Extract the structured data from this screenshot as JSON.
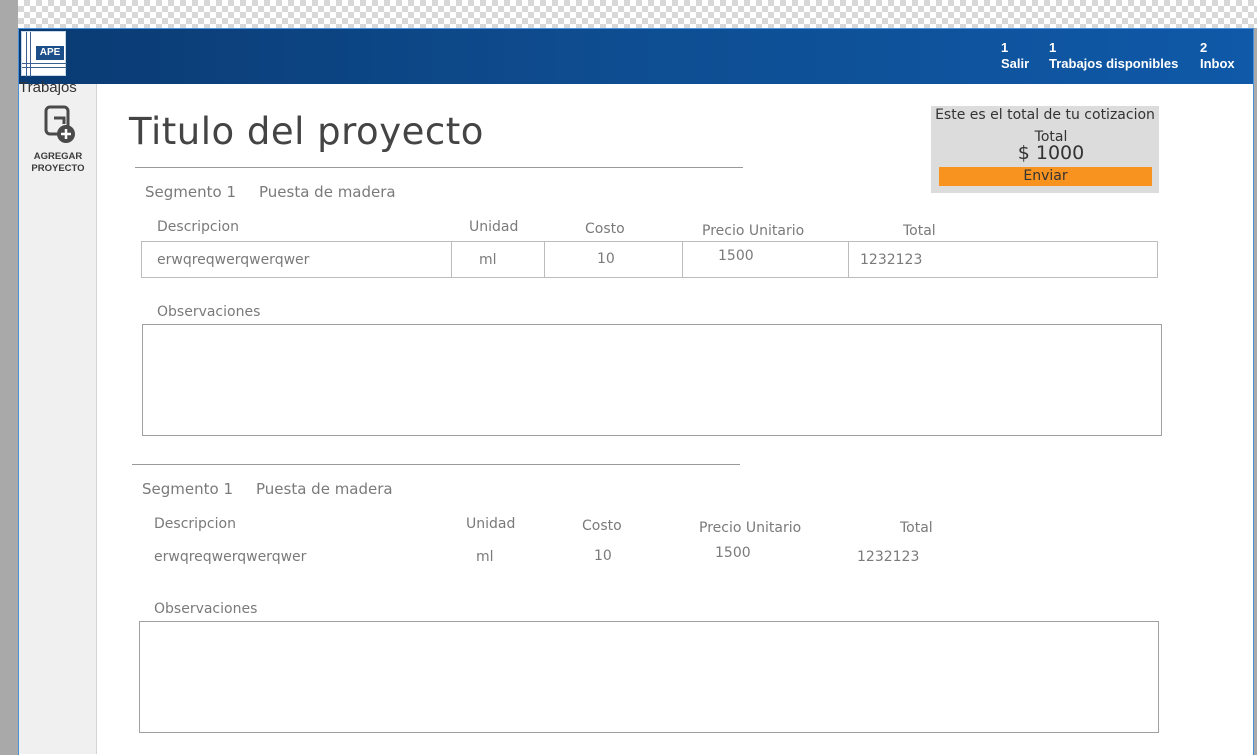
{
  "header": {
    "logo_text": "APE",
    "nav": [
      {
        "count": "1",
        "label": "Salir"
      },
      {
        "count": "1",
        "label": "Trabajos disponibles"
      },
      {
        "count": "2",
        "label": "Inbox"
      }
    ]
  },
  "sidebar": {
    "section_label": "Trabajos",
    "add_project_label_line1": "AGREGAR",
    "add_project_label_line2": "PROYECTO"
  },
  "main": {
    "title": "Titulo del proyecto"
  },
  "quote_summary": {
    "heading": "Este es el total de tu cotizacion",
    "total_label": "Total",
    "total_amount": "$ 1000",
    "submit_label": "Enviar",
    "accent_color": "#f7931e"
  },
  "segments": [
    {
      "segment": "Segmento 1",
      "name": "Puesta de madera",
      "columns": [
        "Descripcion",
        "Unidad",
        "Costo",
        "Precio Unitario",
        "Total"
      ],
      "row": {
        "descripcion": "erwqreqwerqwerqwer",
        "unidad": "ml",
        "costo": "10",
        "precio_unitario": "1500",
        "total": "1232123"
      },
      "observations_label": "Observaciones",
      "observations_value": ""
    },
    {
      "segment": "Segmento 1",
      "name": "Puesta de madera",
      "columns": [
        "Descripcion",
        "Unidad",
        "Costo",
        "Precio Unitario",
        "Total"
      ],
      "row": {
        "descripcion": "erwqreqwerqwerqwer",
        "unidad": "ml",
        "costo": "10",
        "precio_unitario": "1500",
        "total": "1232123"
      },
      "observations_label": "Observaciones",
      "observations_value": ""
    }
  ],
  "colors": {
    "header_start": "#0a3a72",
    "header_end": "#0f59a8"
  }
}
